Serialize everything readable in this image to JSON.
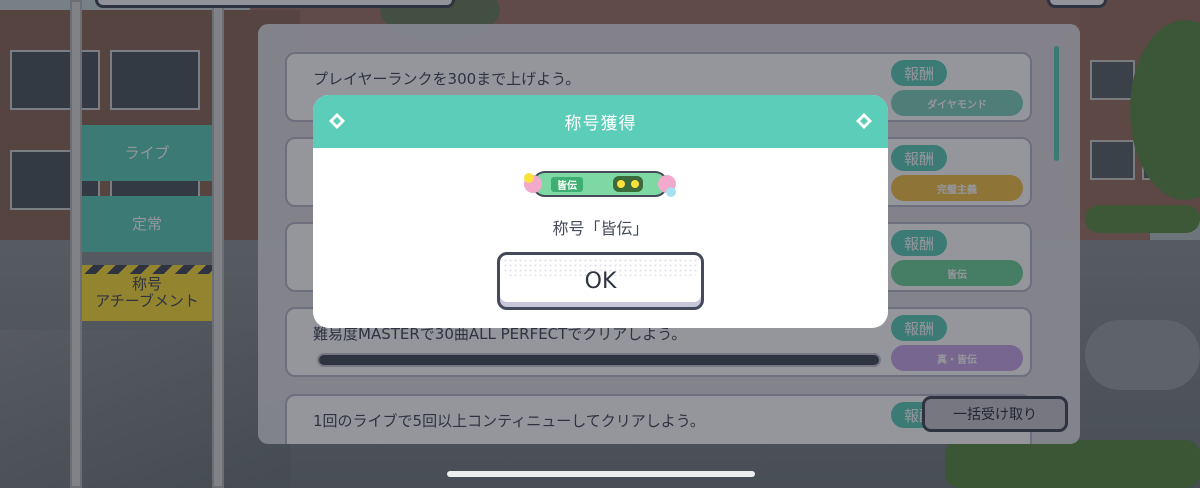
{
  "side_tabs": [
    {
      "label": "ライブ",
      "active": false
    },
    {
      "label": "定常",
      "active": false
    },
    {
      "label": "称号\nアチーブメント",
      "active": true
    }
  ],
  "missions": [
    {
      "text": "プレイヤーランクを300まで上げよう。",
      "reward_label": "報酬",
      "reward_item": "ダイヤモンド",
      "reward_color": "#7fd3bc",
      "has_progress": false
    },
    {
      "text": "",
      "reward_label": "報酬",
      "reward_item": "完璧主義",
      "reward_color": "#f4c24a",
      "has_progress": false
    },
    {
      "text": "",
      "reward_label": "報酬",
      "reward_item": "皆伝",
      "reward_color": "#6fd29b",
      "has_progress": false
    },
    {
      "text": "難易度MASTERで30曲ALL PERFECTでクリアしよう。",
      "reward_label": "報酬",
      "reward_item": "真・皆伝",
      "reward_color": "#c8a8e8",
      "has_progress": true
    },
    {
      "text": "1回のライブで5回以上コンティニューしてクリアしよう。",
      "reward_label": "報酬",
      "reward_item": "",
      "reward_color": "#7fd3bc",
      "has_progress": false
    }
  ],
  "bulk_receive_label": "一括受け取り",
  "dialog": {
    "title": "称号獲得",
    "title_plate_text": "皆伝",
    "acquired_text": "称号「皆伝」",
    "ok_label": "OK"
  },
  "colors": {
    "accent": "#5ccdb9",
    "active_tab": "#fbe13b",
    "dark": "#444a5a"
  },
  "icons": [
    "diamond-icon",
    "title-plate-icon",
    "home-indicator"
  ]
}
